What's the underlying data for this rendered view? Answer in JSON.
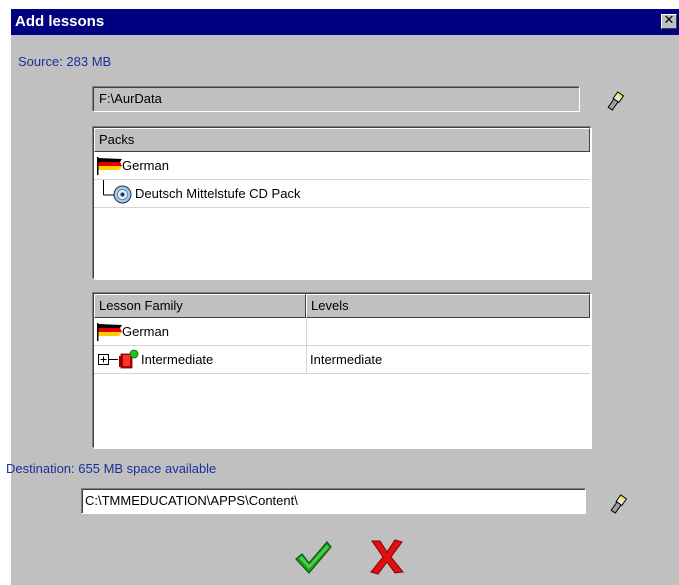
{
  "window": {
    "title": "Add lessons",
    "close_label": "✕"
  },
  "source": {
    "label": "Source: 283 MB",
    "path": "F:\\AurData"
  },
  "packs": {
    "header": "Packs",
    "items": [
      {
        "label": "German",
        "icon": "german-flag-icon"
      },
      {
        "label": "Deutsch Mittelstufe CD Pack",
        "icon": "cd-icon"
      }
    ]
  },
  "lessons": {
    "columns": [
      "Lesson Family",
      "Levels"
    ],
    "rows": [
      {
        "family": "German",
        "level": "",
        "icon": "german-flag-icon"
      },
      {
        "family": "Intermediate",
        "level": "Intermediate",
        "icon": "book-icon"
      }
    ]
  },
  "destination": {
    "label": "Destination: 655 MB space available",
    "path": "C:\\TMMEDUCATION\\APPS\\Content\\"
  },
  "actions": {
    "ok_icon": "green-check-icon",
    "cancel_icon": "red-x-icon"
  },
  "colors": {
    "title_bar": "#000080",
    "label_text": "#1a2f9a",
    "ok": "#1f9a1f",
    "cancel": "#e01010"
  }
}
